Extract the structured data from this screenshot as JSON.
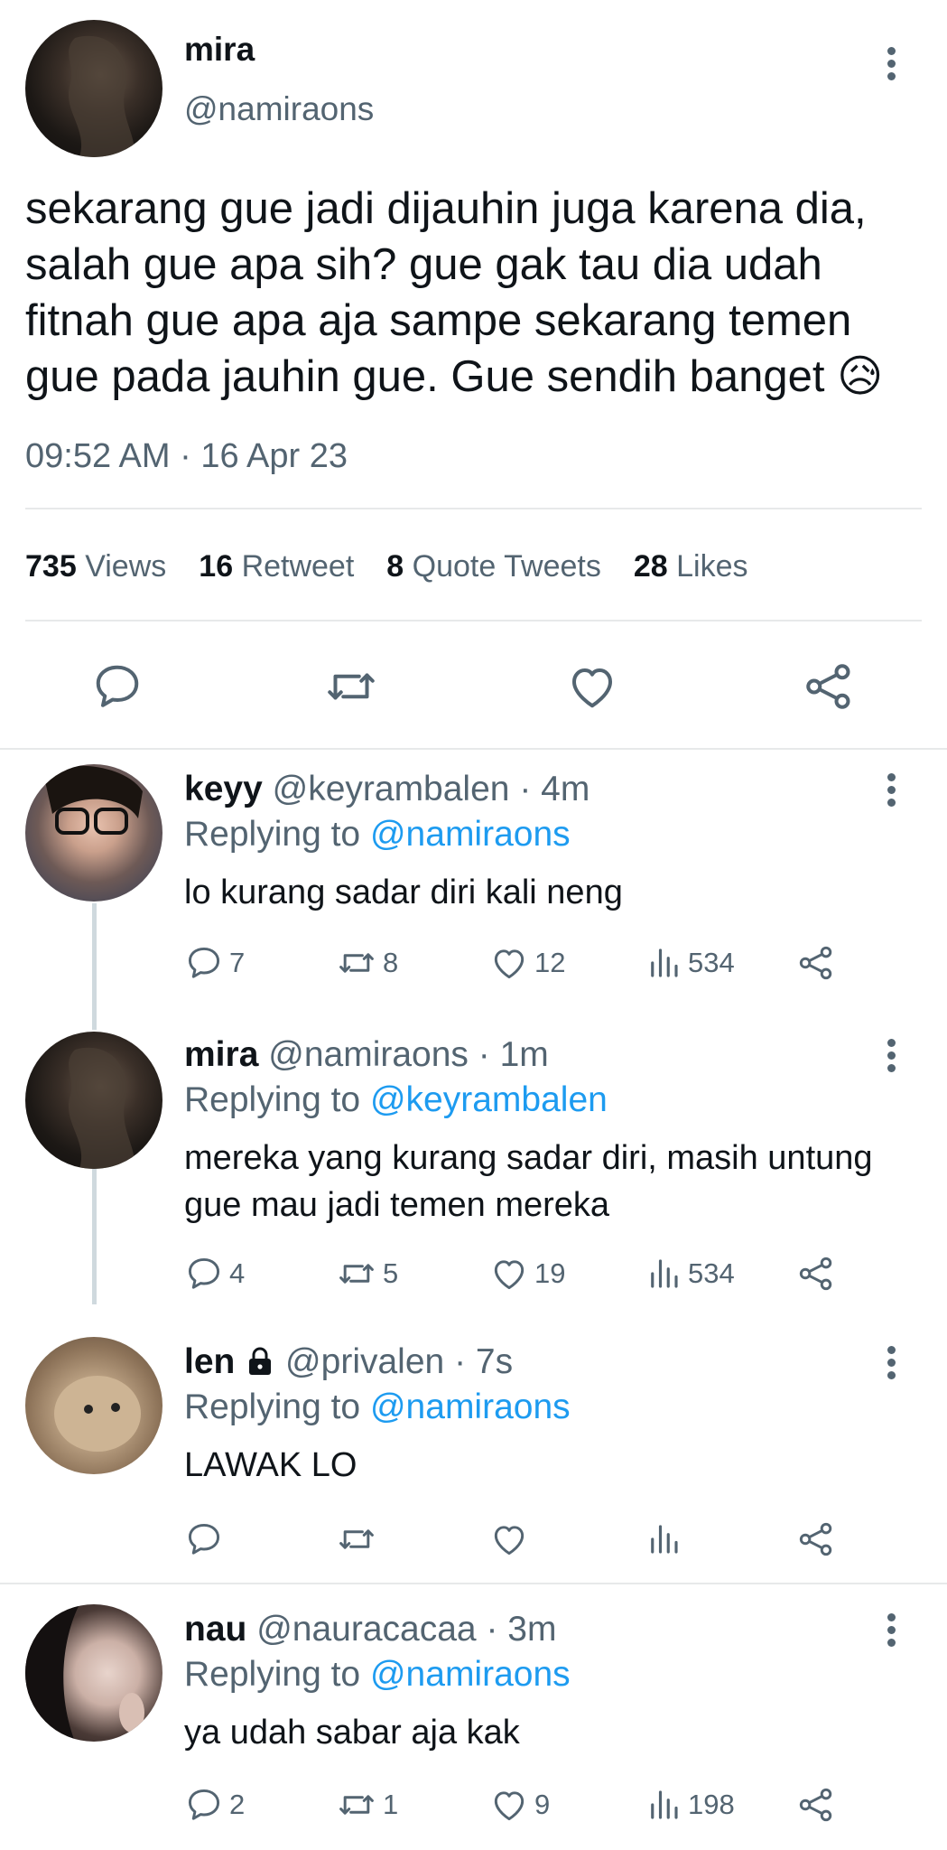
{
  "main_tweet": {
    "name": "mira",
    "handle": "@namiraons",
    "text": "sekarang gue jadi dijauhin juga karena dia, salah gue apa sih? gue gak tau dia udah fitnah gue apa aja sampe sekarang temen gue pada jauhin gue. Gue sendih banget",
    "emoji": "😥",
    "timestamp": "09:52 AM · 16 Apr 23",
    "stats": {
      "views_count": "735",
      "views_label": "Views",
      "retweet_count": "16",
      "retweet_label": "Retweet",
      "quote_count": "8",
      "quote_label": "Quote Tweets",
      "likes_count": "28",
      "likes_label": "Likes"
    }
  },
  "replies": [
    {
      "name": "keyy",
      "handle": "@keyrambalen",
      "time": "· 4m",
      "replying_label": "Replying to",
      "replying_to": "@namiraons",
      "text": "lo kurang sadar diri kali neng",
      "replies": "7",
      "retweets": "8",
      "likes": "12",
      "views": "534"
    },
    {
      "name": "mira",
      "handle": "@namiraons",
      "time": "· 1m",
      "replying_label": "Replying to",
      "replying_to": "@keyrambalen",
      "text": "mereka yang kurang sadar diri, masih untung gue mau jadi temen mereka",
      "replies": "4",
      "retweets": "5",
      "likes": "19",
      "views": "534"
    },
    {
      "name": "len",
      "handle": "@privalen",
      "time": "· 7s",
      "replying_label": "Replying to",
      "replying_to": "@namiraons",
      "text": "LAWAK LO",
      "replies": "",
      "retweets": "",
      "likes": "",
      "views": ""
    },
    {
      "name": "nau",
      "handle": "@nauracacaa",
      "time": "· 3m",
      "replying_label": "Replying to",
      "replying_to": "@namiraons",
      "text": "ya udah sabar aja kak",
      "replies": "2",
      "retweets": "1",
      "likes": "9",
      "views": "198"
    }
  ],
  "icons": {
    "reply": "speech-bubble-icon",
    "retweet": "retweet-arrows-icon",
    "like": "heart-icon",
    "views": "bar-chart-icon",
    "share": "share-nodes-icon",
    "more": "vertical-ellipsis-icon",
    "protected": "lock-icon"
  },
  "colors": {
    "text": "#0f1419",
    "secondary": "#536471",
    "link": "#1d9bf0",
    "divider": "#e7e9ea"
  }
}
